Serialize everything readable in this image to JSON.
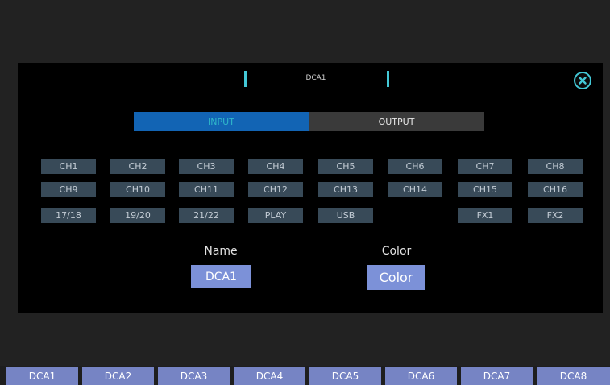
{
  "dialog": {
    "title": "DCA1",
    "close_icon": "close-circle-icon",
    "tabs": [
      {
        "label": "INPUT",
        "active": true
      },
      {
        "label": "OUTPUT",
        "active": false
      }
    ],
    "channels": [
      "CH1",
      "CH2",
      "CH3",
      "CH4",
      "CH5",
      "CH6",
      "CH7",
      "CH8",
      "CH9",
      "CH10",
      "CH11",
      "CH12",
      "CH13",
      "CH14",
      "CH15",
      "CH16",
      "17/18",
      "19/20",
      "21/22",
      "PLAY",
      "USB",
      "FX1",
      "FX2"
    ],
    "name_label": "Name",
    "name_value": "DCA1",
    "color_label": "Color",
    "color_value": "Color",
    "colors": {
      "accent": "#43c8d6",
      "active_tab": "#1264b4",
      "channel_button": "#384a58",
      "value_box": "#7c91d8"
    }
  },
  "dca_bar": [
    "DCA1",
    "DCA2",
    "DCA3",
    "DCA4",
    "DCA5",
    "DCA6",
    "DCA7",
    "DCA8"
  ]
}
